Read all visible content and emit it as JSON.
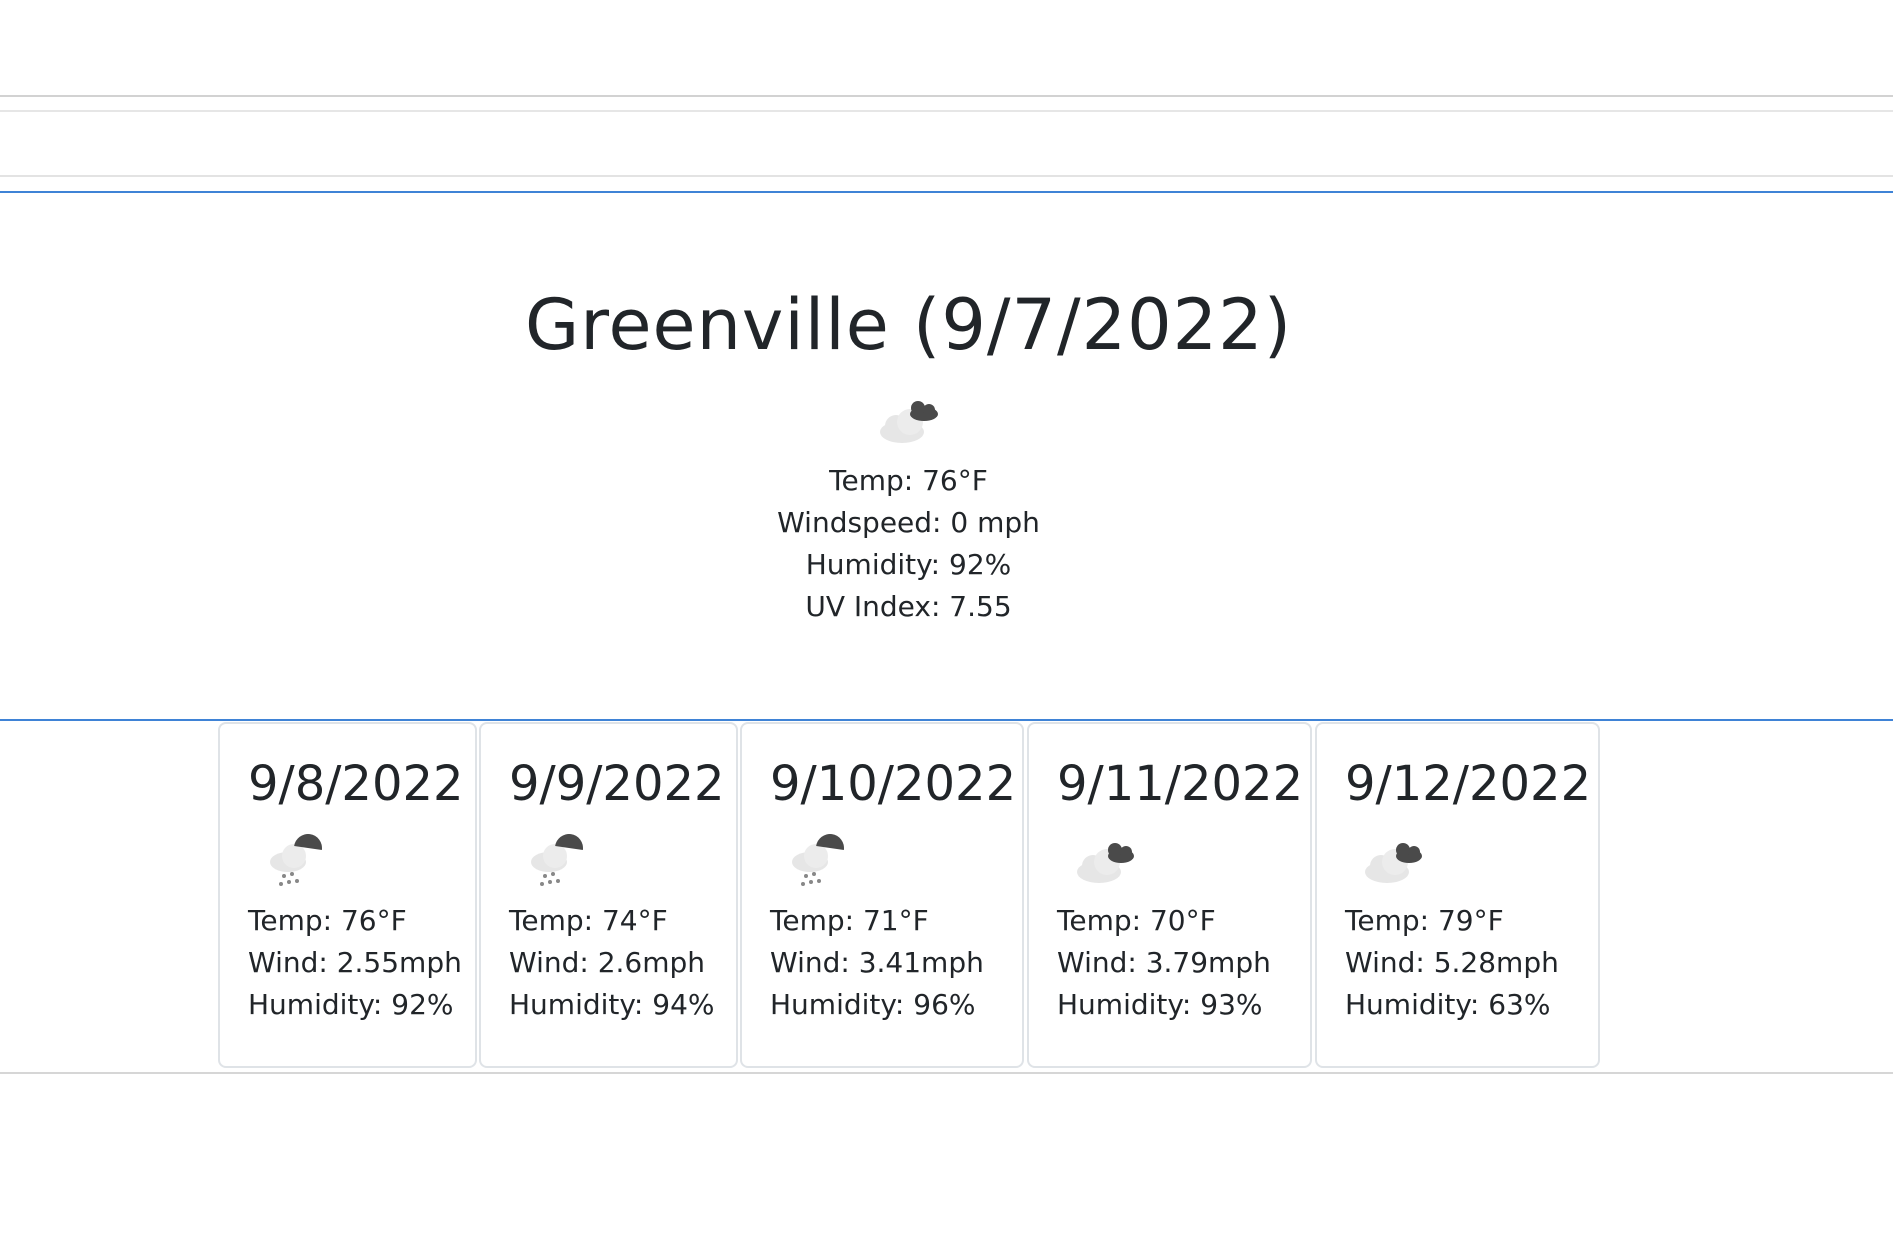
{
  "current": {
    "title": "Greenville (9/7/2022)",
    "icon": "cloudy-icon",
    "temp": "Temp: 76°F",
    "windspeed": "Windspeed: 0 mph",
    "humidity": "Humidity: 92%",
    "uv_index": "UV Index: 7.55"
  },
  "forecast": [
    {
      "date": "9/8/2022",
      "icon": "rain-icon",
      "temp": "Temp: 76°F",
      "wind": "Wind: 2.55mph",
      "humidity": "Humidity: 92%"
    },
    {
      "date": "9/9/2022",
      "icon": "rain-icon",
      "temp": "Temp: 74°F",
      "wind": "Wind: 2.6mph",
      "humidity": "Humidity: 94%"
    },
    {
      "date": "9/10/2022",
      "icon": "rain-icon",
      "temp": "Temp: 71°F",
      "wind": "Wind: 3.41mph",
      "humidity": "Humidity: 96%"
    },
    {
      "date": "9/11/2022",
      "icon": "cloudy-icon",
      "temp": "Temp: 70°F",
      "wind": "Wind: 3.79mph",
      "humidity": "Humidity: 93%"
    },
    {
      "date": "9/12/2022",
      "icon": "cloudy-icon",
      "temp": "Temp: 79°F",
      "wind": "Wind: 5.28mph",
      "humidity": "Humidity: 63%"
    }
  ],
  "colors": {
    "text": "#212529",
    "accent_line": "#3f83d6",
    "card_border": "#dfe3e7",
    "cloud_light": "#e6e6e6",
    "cloud_dark": "#4a4a4a"
  }
}
